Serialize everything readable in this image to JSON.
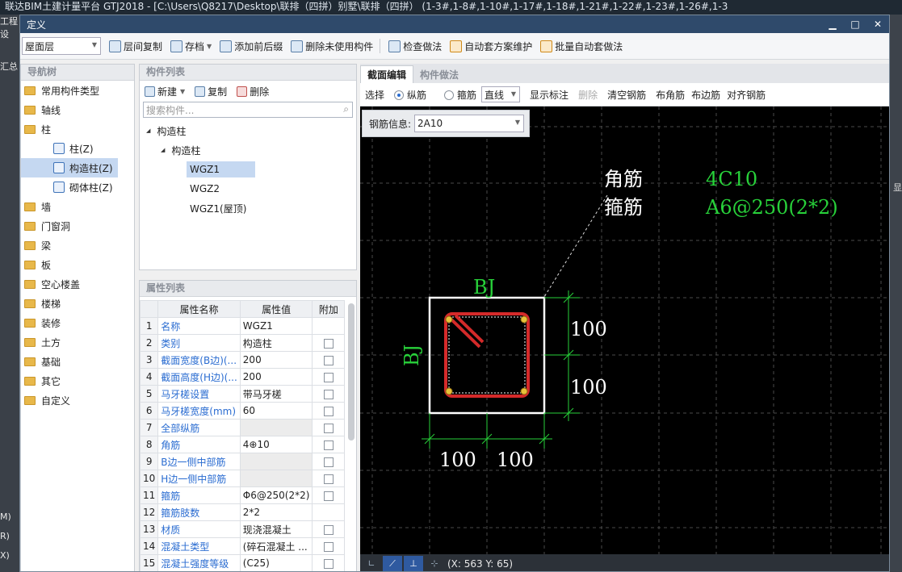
{
  "bg_window": {
    "title_partial": "联达BIM土建计量平台 GTJ2018 - [C:\\Users\\Q8217\\Desktop\\联排（四拼）别墅\\联排（四拼）    (1-3#,1-8#,1-10#,1-17#,1-18#,1-21#,1-22#,1-23#,1-26#,1-3",
    "left_labels": [
      "工程设",
      "汇总",
      "M)",
      "R)",
      "X)"
    ],
    "right_label": "显"
  },
  "dialog": {
    "title": "定义"
  },
  "toolbar": {
    "floor": "屋面层",
    "items": [
      "层间复制",
      "存档",
      "添加前后缀",
      "删除未使用构件",
      "检查做法",
      "自动套方案维护",
      "批量自动套做法"
    ]
  },
  "nav": {
    "header": "导航树",
    "items": [
      {
        "label": "常用构件类型"
      },
      {
        "label": "轴线"
      },
      {
        "label": "柱"
      },
      {
        "label": "柱(Z)",
        "sub": true
      },
      {
        "label": "构造柱(Z)",
        "sub": true,
        "selected": true
      },
      {
        "label": "砌体柱(Z)",
        "sub": true
      },
      {
        "label": "墙"
      },
      {
        "label": "门窗洞"
      },
      {
        "label": "梁"
      },
      {
        "label": "板"
      },
      {
        "label": "空心楼盖"
      },
      {
        "label": "楼梯"
      },
      {
        "label": "装修"
      },
      {
        "label": "土方"
      },
      {
        "label": "基础"
      },
      {
        "label": "其它"
      },
      {
        "label": "自定义"
      }
    ]
  },
  "complist": {
    "header": "构件列表",
    "new": "新建",
    "copy": "复制",
    "delete": "删除",
    "search_placeholder": "搜索构件...",
    "tree": [
      {
        "label": "构造柱",
        "level": 0
      },
      {
        "label": "构造柱",
        "level": 1
      },
      {
        "label": "WGZ1",
        "level": 2,
        "selected": true
      },
      {
        "label": "WGZ2",
        "level": 2
      },
      {
        "label": "WGZ1(屋顶)",
        "level": 2
      }
    ]
  },
  "props": {
    "header": "属性列表",
    "cols": [
      "属性名称",
      "属性值",
      "附加"
    ],
    "rows": [
      {
        "n": "1",
        "name": "名称",
        "val": "WGZ1",
        "chk": false
      },
      {
        "n": "2",
        "name": "类别",
        "val": "构造柱",
        "chk": true
      },
      {
        "n": "3",
        "name": "截面宽度(B边)(...",
        "val": "200",
        "chk": true
      },
      {
        "n": "4",
        "name": "截面高度(H边)(...",
        "val": "200",
        "chk": true
      },
      {
        "n": "5",
        "name": "马牙槎设置",
        "val": "带马牙槎",
        "chk": true
      },
      {
        "n": "6",
        "name": "马牙槎宽度(mm)",
        "val": "60",
        "chk": true
      },
      {
        "n": "7",
        "name": "全部纵筋",
        "val": "",
        "chk": true
      },
      {
        "n": "8",
        "name": "角筋",
        "val": "4⊕10",
        "chk": true
      },
      {
        "n": "9",
        "name": "B边一侧中部筋",
        "val": "",
        "chk": true
      },
      {
        "n": "10",
        "name": "H边一侧中部筋",
        "val": "",
        "chk": true
      },
      {
        "n": "11",
        "name": "箍筋",
        "val": "Φ6@250(2*2)",
        "chk": true
      },
      {
        "n": "12",
        "name": "箍筋肢数",
        "val": "2*2",
        "chk": false
      },
      {
        "n": "13",
        "name": "材质",
        "val": "现浇混凝土",
        "chk": true
      },
      {
        "n": "14",
        "name": "混凝土类型",
        "val": "(碎石混凝土 ...",
        "chk": true
      },
      {
        "n": "15",
        "name": "混凝土强度等级",
        "val": "(C25)",
        "chk": true
      }
    ]
  },
  "editor": {
    "tabs": [
      "截面编辑",
      "构件做法"
    ],
    "tools": {
      "select": "选择",
      "long_bar": "纵筋",
      "stirrup": "箍筋",
      "line_mode": "直线",
      "show_label": "显示标注",
      "delete": "删除",
      "clear": "清空钢筋",
      "corner": "布角筋",
      "edge": "布边筋",
      "align": "对齐钢筋"
    },
    "rebar_info_label": "钢筋信息:",
    "rebar_info_value": "2A10",
    "drawing": {
      "label_corner": "角筋",
      "label_stirrup": "箍筋",
      "corner_value": "4C10",
      "stirrup_value": "A6@250(2*2)",
      "bj_top": "BJ",
      "bj_left": "BJ",
      "dim_right_1": "100",
      "dim_right_2": "100",
      "dim_bottom_1": "100",
      "dim_bottom_2": "100"
    },
    "status_coords": "(X: 563 Y: 65)"
  },
  "colors": {
    "title_bar": "#2f4a6b",
    "selected": "#c5d8f1",
    "link_blue": "#2a6cd1",
    "canvas_bg": "#000000",
    "dim_green": "#28d13a",
    "rebar_red": "#d42a2a",
    "label_white": "#ffffff"
  }
}
